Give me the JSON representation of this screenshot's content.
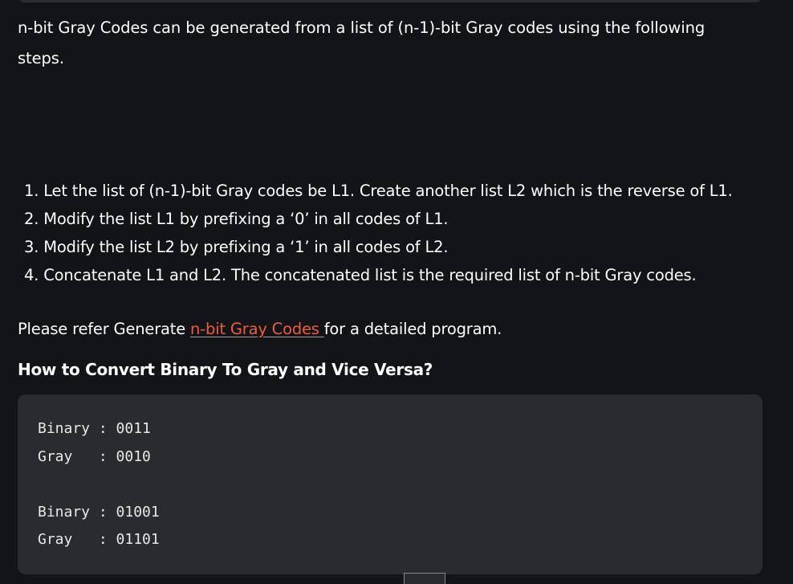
{
  "intro": {
    "text": "n-bit Gray Codes can be generated from a list of (n-1)-bit Gray codes using the following steps."
  },
  "steps": [
    "1. Let the list of (n-1)-bit Gray codes be L1. Create another list L2 which is the reverse of L1.",
    "2. Modify the list L1 by prefixing a ‘0’ in all codes of L1.",
    "3. Modify the list L2 by prefixing a ‘1’ in all codes of L2.",
    "4. Concatenate L1 and L2. The concatenated list is the required list of n-bit Gray codes."
  ],
  "refer": {
    "prefix": "Please refer Generate ",
    "link_text": "n-bit Gray Codes ",
    "suffix": "for a detailed program."
  },
  "section_heading": "How to Convert Binary To Gray and Vice Versa?",
  "code_example": {
    "lines": [
      "Binary : 0011",
      "Gray   : 0010",
      "",
      "Binary : 01001",
      "Gray   : 01101"
    ]
  },
  "colors": {
    "background": "#131417",
    "code_background": "#2a2b2f",
    "link": "#ee5b3a",
    "text": "#ffffff"
  }
}
